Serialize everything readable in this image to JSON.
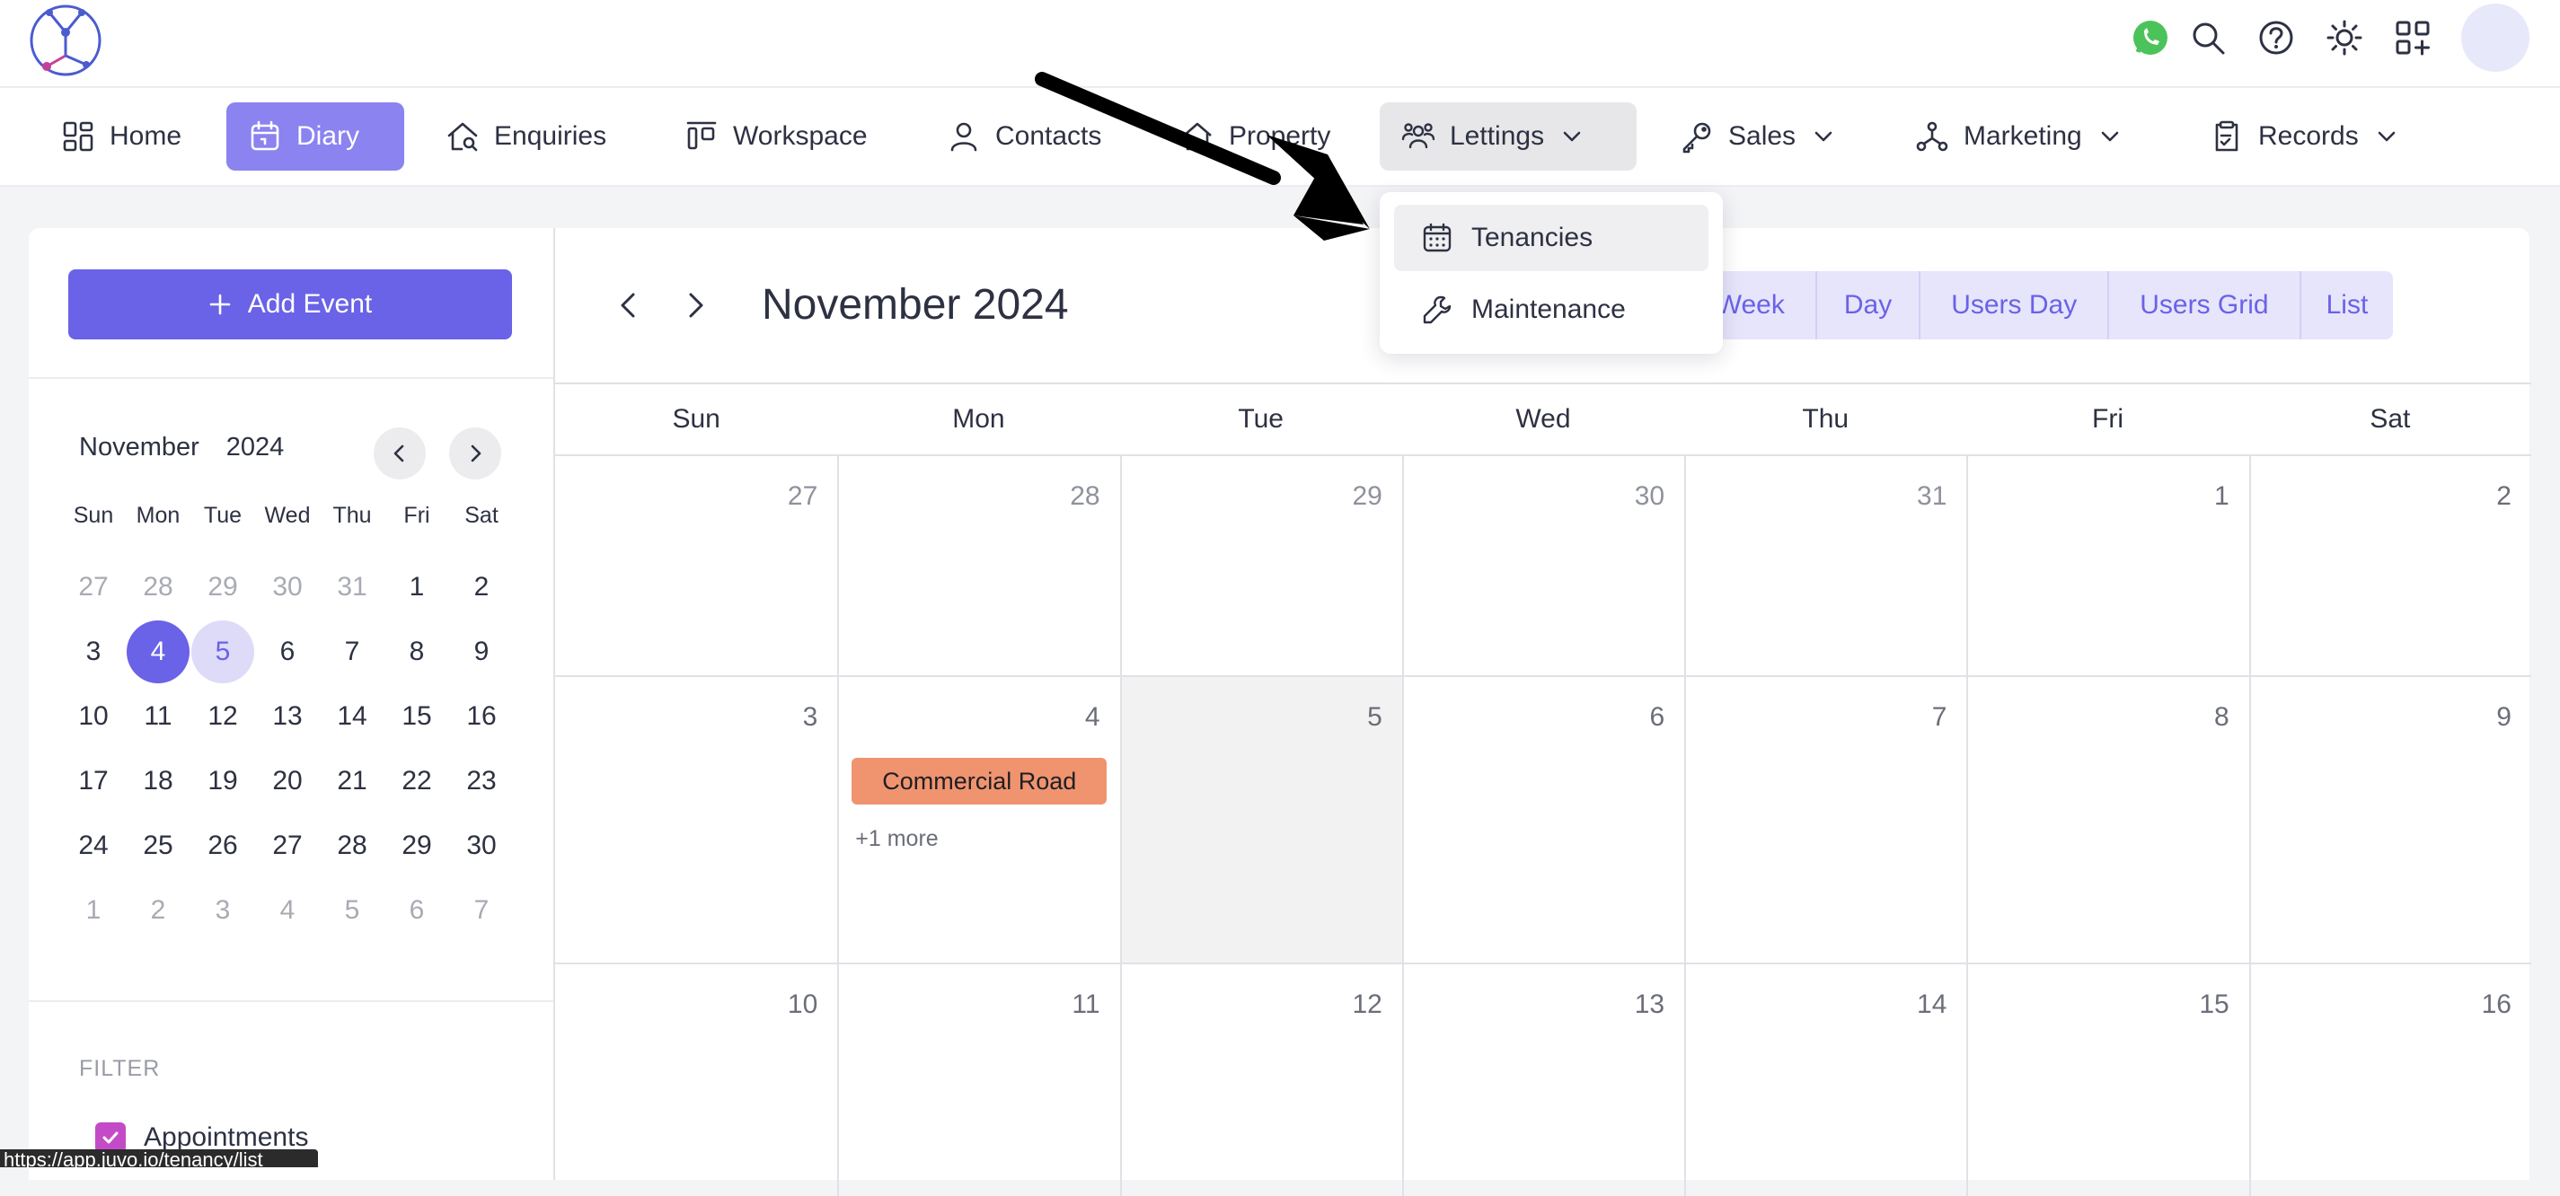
{
  "nav": {
    "items": [
      {
        "label": "Home"
      },
      {
        "label": "Diary"
      },
      {
        "label": "Enquiries"
      },
      {
        "label": "Workspace"
      },
      {
        "label": "Contacts"
      },
      {
        "label": "Property"
      },
      {
        "label": "Lettings"
      },
      {
        "label": "Sales"
      },
      {
        "label": "Marketing"
      },
      {
        "label": "Records"
      }
    ]
  },
  "lettings_menu": {
    "items": [
      {
        "label": "Tenancies"
      },
      {
        "label": "Maintenance"
      }
    ]
  },
  "sidebar": {
    "add_event_label": "Add Event",
    "mini_month": "November",
    "mini_year": "2024",
    "weekdays": [
      "Sun",
      "Mon",
      "Tue",
      "Wed",
      "Thu",
      "Fri",
      "Sat"
    ],
    "days": [
      [
        "27",
        "28",
        "29",
        "30",
        "31",
        "1",
        "2"
      ],
      [
        "3",
        "4",
        "5",
        "6",
        "7",
        "8",
        "9"
      ],
      [
        "10",
        "11",
        "12",
        "13",
        "14",
        "15",
        "16"
      ],
      [
        "17",
        "18",
        "19",
        "20",
        "21",
        "22",
        "23"
      ],
      [
        "24",
        "25",
        "26",
        "27",
        "28",
        "29",
        "30"
      ],
      [
        "1",
        "2",
        "3",
        "4",
        "5",
        "6",
        "7"
      ]
    ],
    "filter_title": "FILTER",
    "filter_items": [
      {
        "label": "Appointments"
      }
    ]
  },
  "calendar": {
    "title": "November 2024",
    "views": [
      "n",
      "Week",
      "Day",
      "Users Day",
      "Users Grid",
      "List"
    ],
    "weekdays": [
      "Sun",
      "Mon",
      "Tue",
      "Wed",
      "Thu",
      "Fri",
      "Sat"
    ],
    "weeks": [
      [
        "27",
        "28",
        "29",
        "30",
        "31",
        "1",
        "2"
      ],
      [
        "3",
        "4",
        "5",
        "6",
        "7",
        "8",
        "9"
      ],
      [
        "10",
        "11",
        "12",
        "13",
        "14",
        "15",
        "16"
      ]
    ],
    "event_label": "Commercial Road",
    "more_label": "+1 more"
  },
  "status_url": "https://app.juvo.io/tenancy/list",
  "colors": {
    "accent": "#6a62e7",
    "event": "#f0946f"
  }
}
